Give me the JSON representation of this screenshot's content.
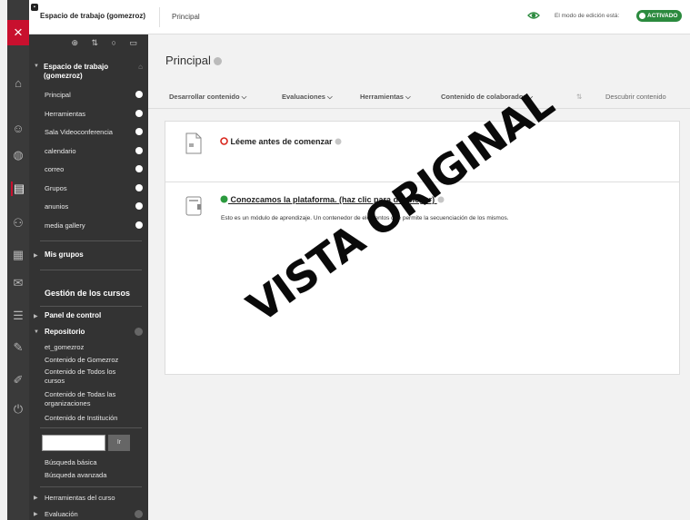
{
  "topbar": {
    "course_title": "Espacio de trabajo (gomezroz)",
    "breadcrumb": "Principal",
    "edit_mode_text": "El modo de edición está:",
    "edit_mode_status": "ACTIVADO"
  },
  "rail": {
    "close": "×",
    "icons": [
      "institution-icon",
      "profile-icon",
      "globe-icon",
      "courses-icon",
      "groups-icon",
      "calendar-icon",
      "messages-icon",
      "grades-icon",
      "tools-icon",
      "edit-icon",
      "signout-icon"
    ]
  },
  "menu": {
    "tools": "⊕ ⇅ ○ ▭",
    "workspace": "Espacio de trabajo (gomezroz)",
    "links": [
      {
        "label": "Principal"
      },
      {
        "label": "Herramientas"
      },
      {
        "label": "Sala Videoconferencia"
      },
      {
        "label": "calendario"
      },
      {
        "label": "correo"
      },
      {
        "label": "Grupos"
      },
      {
        "label": "anunios"
      },
      {
        "label": "media gallery"
      }
    ],
    "my_groups": "Mis grupos",
    "management": "Gestión de los cursos",
    "control_panel": "Panel de control",
    "repository": "Repositorio",
    "repo_items": [
      "et_gomezroz",
      "Contenido de Gomezroz",
      "Contenido de Todos los cursos",
      "Contenido de Todas las organizaciones",
      "Contenido de Institución"
    ],
    "go": "Ir",
    "basic_search": "Búsqueda básica",
    "advanced_search": "Búsqueda avanzada",
    "course_tools": "Herramientas del curso",
    "evaluation": "Evaluación"
  },
  "main": {
    "title": "Principal",
    "actions": [
      "Desarrollar contenido",
      "Evaluaciones",
      "Herramientas",
      "Contenido de colaborador"
    ],
    "discover": "Descubrir contenido",
    "items": [
      {
        "title": "Léeme antes de comenzar",
        "status_color": "#d9261c",
        "description": ""
      },
      {
        "title": "Conozcamos la plataforma. (haz clic para desplegar)",
        "status_color": "#2b9a3e",
        "description": "Esto es un módulo de aprendizaje. Un contenedor de elementos que permite la secuenciación de los mismos."
      }
    ]
  },
  "watermark": "VISTA ORIGINAL",
  "colors": {
    "accent": "#c8102e",
    "menu_bg": "#333333",
    "active_green": "#2b8a3e"
  }
}
